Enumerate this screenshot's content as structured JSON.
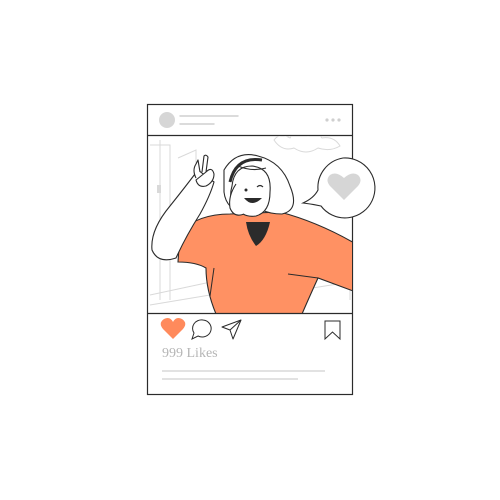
{
  "post": {
    "likes_text": "999 Likes",
    "liked": true
  },
  "icons": {
    "avatar": "avatar-placeholder",
    "more": "more-dots-icon",
    "like": "heart-icon",
    "comment": "comment-icon",
    "share": "send-icon",
    "save": "bookmark-icon",
    "reaction": "heart-speech-bubble-icon"
  },
  "colors": {
    "accent": "#FF9163",
    "heart": "#FF8A5C",
    "placeholder": "#D6D6D6",
    "outline": "#2B2B2B",
    "line": "#CFCFCF"
  }
}
